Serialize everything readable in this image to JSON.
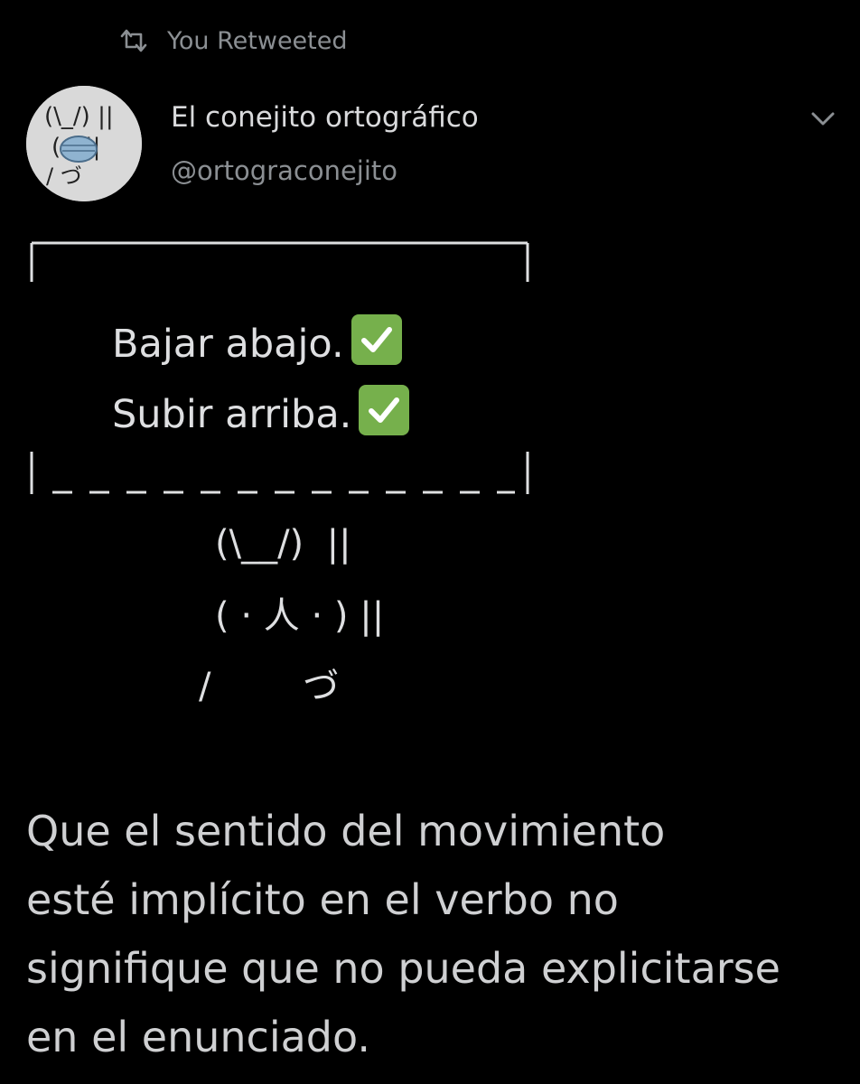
{
  "retweet": {
    "icon": "retweet-icon",
    "label": "You Retweeted"
  },
  "author": {
    "name": "El conejito ortográfico",
    "handle": "@ortograconejito",
    "avatar": "bunny-with-mask-avatar"
  },
  "menu": {
    "icon": "chevron-down-icon"
  },
  "sign": {
    "line1": "Bajar abajo.",
    "line2": "Subir arriba.",
    "check_icon": "check-mark-button-icon",
    "check_color": "#76b04c"
  },
  "bunny": {
    "ears": "(\\__/)  ||",
    "face": "( · 人 · ) ||",
    "arms": "/        づ"
  },
  "tweet": {
    "lines": [
      "Que el sentido del movimiento",
      "esté implícito en el verbo no",
      "signifique que no pueda explicitarse",
      "en el enunciado."
    ]
  }
}
